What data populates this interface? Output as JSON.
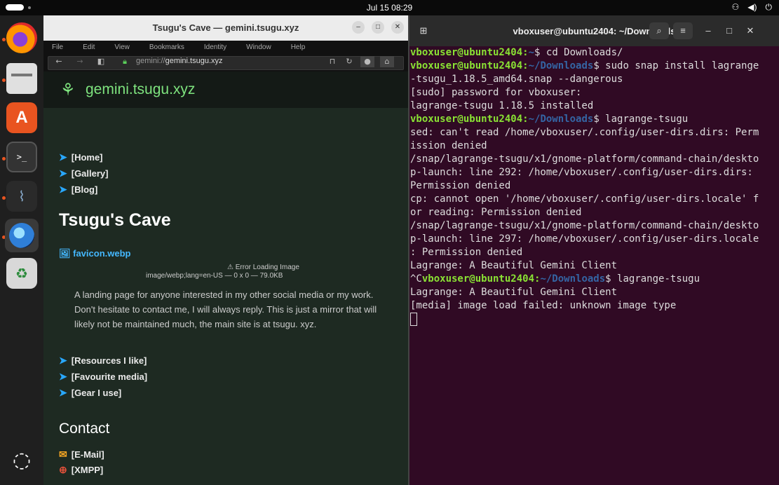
{
  "topbar": {
    "clock": "Jul 15  08:29",
    "tray_icons": [
      "network-icon",
      "volume-icon",
      "power-icon"
    ]
  },
  "dock": {
    "apps": [
      "Firefox",
      "Files",
      "App Center",
      "Terminal",
      "System Monitor",
      "Lagrange",
      "Trash",
      "Show Apps"
    ]
  },
  "lagrange": {
    "title": "Tsugu's Cave — gemini.tsugu.xyz",
    "menu": [
      "File",
      "Edit",
      "View",
      "Bookmarks",
      "Identity",
      "Window",
      "Help"
    ],
    "url_scheme": "gemini://",
    "url_host": "gemini.tsugu.xyz",
    "banner": "gemini.tsugu.xyz",
    "nav_links": [
      "[Home]",
      "[Gallery]",
      "[Blog]"
    ],
    "heading": "Tsugu's Cave",
    "image_link": "favicon.webp",
    "error_title": "Error Loading Image",
    "error_detail": "image/webp;lang=en-US — 0 x 0 — 79.0KB",
    "paragraph": "A landing page for anyone interested in my other social media or my work. Don't hesitate to contact me, I will always reply. This is just a mirror that will likely not be maintained much, the main site is at tsugu. xyz.",
    "more_links": [
      "[Resources I like]",
      "[Favourite media]",
      "[Gear I use]"
    ],
    "contact_heading": "Contact",
    "contact_links": [
      "[E-Mail]",
      "[XMPP]"
    ]
  },
  "terminal": {
    "title": "vboxuser@ubuntu2404: ~/Downloads",
    "lines": [
      {
        "user": "vboxuser@ubuntu2404",
        "dir": "~",
        "cmd": "$ cd Downloads/"
      },
      {
        "user": "vboxuser@ubuntu2404",
        "dir": "~/Downloads",
        "cmd": "$ sudo snap install lagrange"
      },
      {
        "text": "-tsugu_1.18.5_amd64.snap --dangerous"
      },
      {
        "text": "[sudo] password for vboxuser:"
      },
      {
        "text": "lagrange-tsugu 1.18.5 installed"
      },
      {
        "user": "vboxuser@ubuntu2404",
        "dir": "~/Downloads",
        "cmd": "$ lagrange-tsugu"
      },
      {
        "text": "sed: can't read /home/vboxuser/.config/user-dirs.dirs: Perm"
      },
      {
        "text": "ission denied"
      },
      {
        "text": "/snap/lagrange-tsugu/x1/gnome-platform/command-chain/deskto"
      },
      {
        "text": "p-launch: line 292: /home/vboxuser/.config/user-dirs.dirs:"
      },
      {
        "text": "Permission denied"
      },
      {
        "text": "cp: cannot open '/home/vboxuser/.config/user-dirs.locale' f"
      },
      {
        "text": "or reading: Permission denied"
      },
      {
        "text": "/snap/lagrange-tsugu/x1/gnome-platform/command-chain/deskto"
      },
      {
        "text": "p-launch: line 297: /home/vboxuser/.config/user-dirs.locale"
      },
      {
        "text": ": Permission denied"
      },
      {
        "text": "Lagrange: A Beautiful Gemini Client"
      },
      {
        "prefix": "^C",
        "user": "vboxuser@ubuntu2404",
        "dir": "~/Downloads",
        "cmd": "$ lagrange-tsugu"
      },
      {
        "text": "Lagrange: A Beautiful Gemini Client"
      },
      {
        "text": "[media] image load failed: unknown image type"
      }
    ]
  },
  "colors": {
    "accent": "#e95420",
    "terminal_bg": "#300a24",
    "prompt_user": "#8ae234",
    "prompt_dir": "#3465a4",
    "link_arrow": "#29a8ff",
    "banner_text": "#7ee37e"
  }
}
